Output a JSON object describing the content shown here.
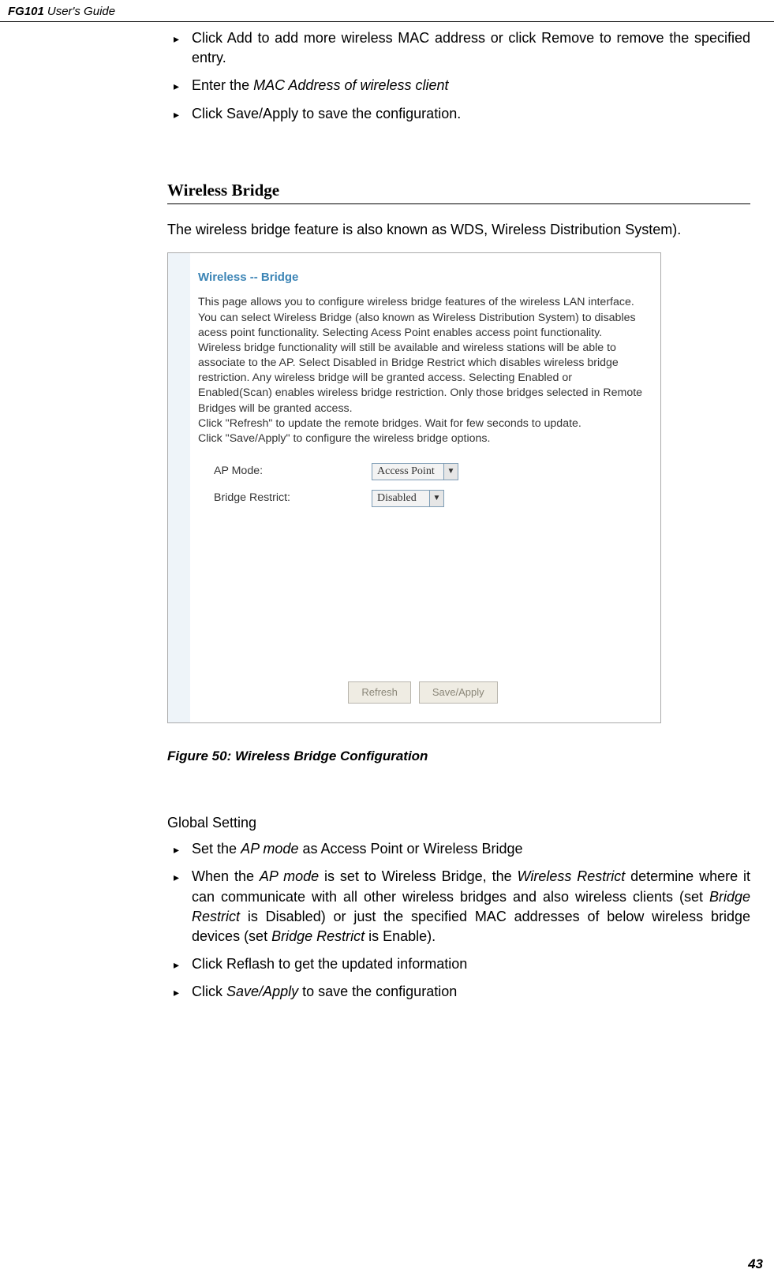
{
  "header": {
    "model": "FG101",
    "guide": "User's Guide"
  },
  "topBullets": [
    {
      "text": "Click Add to add more wireless MAC address or click Remove to remove the specified entry."
    },
    {
      "prefix": "Enter the ",
      "italic": "MAC Address of wireless client"
    },
    {
      "text": "Click Save/Apply to save the configuration."
    }
  ],
  "sectionTitle": "Wireless Bridge",
  "introPara": "The wireless bridge feature is also known as WDS, Wireless Distribution System).",
  "screenshot": {
    "title": "Wireless -- Bridge",
    "desc": "This page allows you to configure wireless bridge features of the wireless LAN interface. You can select Wireless Bridge (also known as Wireless Distribution System) to disables acess point functionality. Selecting Acess Point enables access point functionality. Wireless bridge functionality will still be available and wireless stations will be able to associate to the AP. Select Disabled in Bridge Restrict which disables wireless bridge restriction. Any wireless bridge will be granted access. Selecting Enabled or Enabled(Scan) enables wireless bridge restriction. Only those bridges selected in Remote Bridges will be granted access.\nClick \"Refresh\" to update the remote bridges. Wait for few seconds to update.\nClick \"Save/Apply\" to configure the wireless bridge options.",
    "apModeLabel": "AP Mode:",
    "apModeValue": "Access Point",
    "bridgeRestrictLabel": "Bridge Restrict:",
    "bridgeRestrictValue": "Disabled",
    "refreshBtn": "Refresh",
    "saveBtn": "Save/Apply"
  },
  "figureCaption": "Figure 50: Wireless Bridge Configuration",
  "globalSettingLabel": "Global Setting",
  "bottomBullets": {
    "b1_prefix": "Set the ",
    "b1_italic": "AP mode",
    "b1_suffix": " as Access Point or Wireless Bridge",
    "b2_p1": "When the ",
    "b2_i1": "AP mode",
    "b2_p2": " is set to Wireless Bridge, the ",
    "b2_i2": "Wireless Restrict",
    "b2_p3": " determine where it can communicate with all other wireless bridges and also wireless clients (set ",
    "b2_i3": "Bridge Restrict",
    "b2_p4": " is Disabled) or just the specified MAC addresses of below wireless bridge devices (set ",
    "b2_i4": "Bridge Restrict",
    "b2_p5": " is Enable).",
    "b3": "Click Reflash to get the updated information",
    "b4_p1": "Click ",
    "b4_i1": "Save/Apply",
    "b4_p2": " to save the configuration"
  },
  "pageNumber": "43"
}
